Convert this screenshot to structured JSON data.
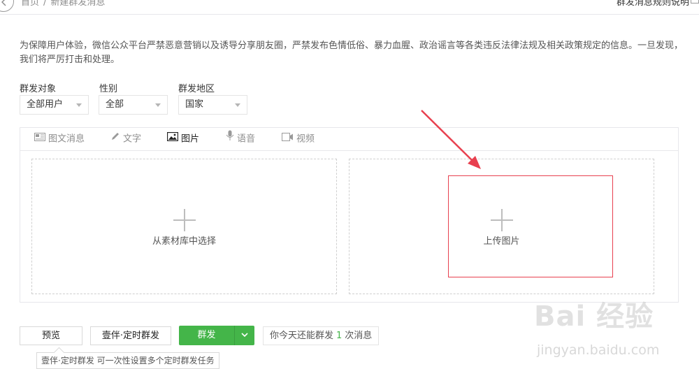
{
  "breadcrumb": {
    "home": "首页",
    "separator": "/",
    "current": "新建群发消息"
  },
  "help_link": "群发消息规则说明",
  "notice": "为保障用户体验，微信公众平台严禁恶意营销以及诱导分享朋友圈，严禁发布色情低俗、暴力血腥、政治谣言等各类违反法律法规及相关政策规定的信息。一旦发现，我们将严厉打击和处理。",
  "filters": {
    "target": {
      "label": "群发对象",
      "value": "全部用户"
    },
    "gender": {
      "label": "性别",
      "value": "全部"
    },
    "region": {
      "label": "群发地区",
      "value": "国家"
    }
  },
  "tabs": [
    {
      "label": "图文消息",
      "icon": "news-icon"
    },
    {
      "label": "文字",
      "icon": "pencil-icon"
    },
    {
      "label": "图片",
      "icon": "image-icon",
      "active": true
    },
    {
      "label": "语音",
      "icon": "microphone-icon"
    },
    {
      "label": "视频",
      "icon": "video-icon"
    }
  ],
  "upload": {
    "library_label": "从素材库中选择",
    "upload_label": "上传图片"
  },
  "actions": {
    "preview": "预览",
    "scheduled": "壹伴·定时群发",
    "send": "群发",
    "quota_prefix": "你今天还能群发",
    "quota_count": "1",
    "quota_suffix": "次消息"
  },
  "tooltip": "壹伴·定时群发 可一次性设置多个定时群发任务",
  "watermark": {
    "brand": "Bai 经验",
    "url": "jingyan.baidu.com"
  },
  "colors": {
    "accent_green": "#44b549",
    "highlight_red": "#e8404f"
  }
}
